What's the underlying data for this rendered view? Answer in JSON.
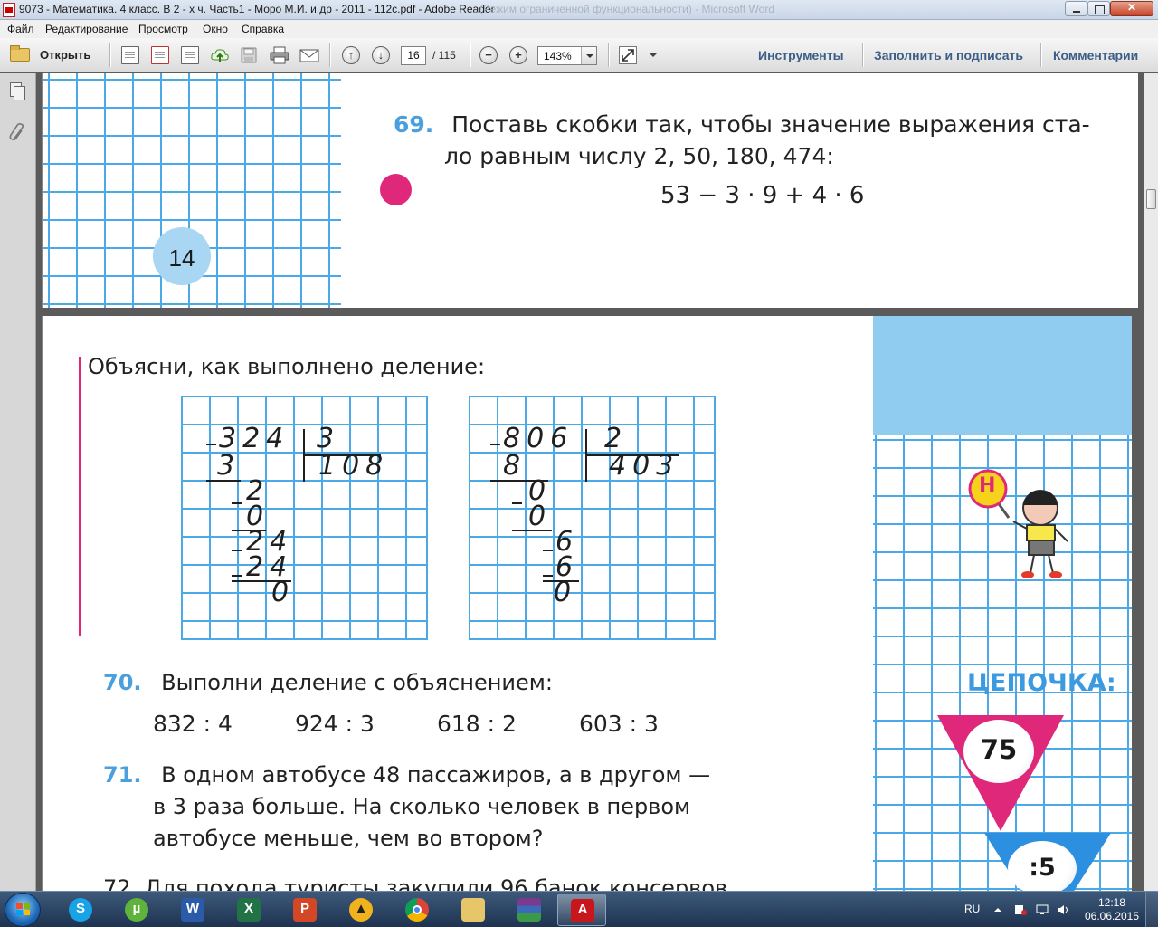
{
  "window": {
    "title": "9073 - Математика. 4 класс. В 2 - х ч. Часть1 - Моро М.И. и др - 2011 - 112с.pdf - Adobe Reader",
    "ghost_title": "...(Режим ограниченной функциональности) - Microsoft Word"
  },
  "menu": [
    "Файл",
    "Редактирование",
    "Просмотр",
    "Окно",
    "Справка"
  ],
  "toolbar": {
    "open_label": "Открыть",
    "page_current": "16",
    "page_total": "/ 115",
    "zoom": "143%",
    "tools_label": "Инструменты",
    "fill_sign_label": "Заполнить и подписать",
    "comments_label": "Комментарии"
  },
  "page1": {
    "page_number": "14",
    "task69_number": "69.",
    "task69_line1": "Поставь скобки так, чтобы значение выражения ста-",
    "task69_line2": "ло  равным  числу  2,  50,  180,  474:",
    "task69_expr": "53 − 3 · 9 + 4 · 6"
  },
  "page2": {
    "explain_heading": "Объясни,  как  выполнено  деление:",
    "division1": {
      "dividend": "324",
      "divisor": "3",
      "quotient": "108",
      "steps": [
        "3",
        "2",
        "0",
        "24",
        "24",
        "0"
      ]
    },
    "division2": {
      "dividend": "806",
      "divisor": "2",
      "quotient": "403",
      "steps": [
        "8",
        "0",
        "0",
        "6",
        "6",
        "0"
      ]
    },
    "task70_number": "70.",
    "task70_text": "Выполни  деление  с  объяснением:",
    "task70_examples": [
      "832 : 4",
      "924 : 3",
      "618 : 2",
      "603 : 3"
    ],
    "task71_number": "71.",
    "task71_line1": "В  одном  автобусе  48  пассажиров,  а  в  другом  —",
    "task71_line2": "в  3  раза  больше.  На  сколько  человек  в  первом",
    "task71_line3": "автобусе  меньше,  чем  во  втором?",
    "task72_partial": "72.  Для  похода  туристы  закупили  96  банок  консервов",
    "mascot_letter": "Н",
    "chain_title": "ЦЕПОЧКА:",
    "chain_start": "75",
    "chain_op1": ":5"
  },
  "taskbar": {
    "lang": "RU",
    "time": "12:18",
    "date": "06.06.2015"
  }
}
